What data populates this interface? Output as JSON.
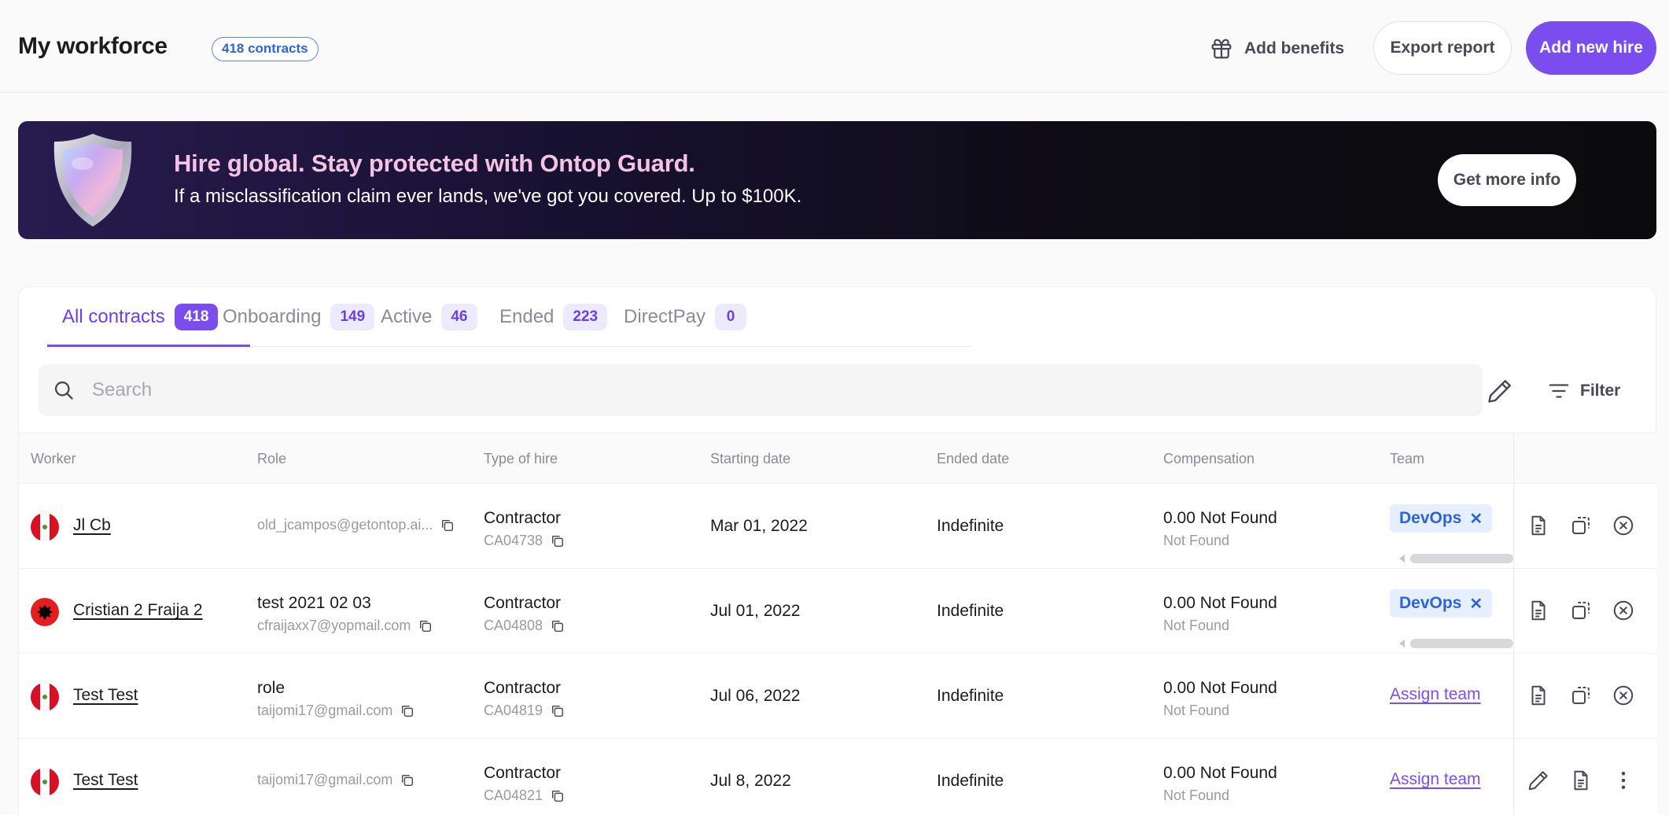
{
  "header": {
    "title": "My workforce",
    "contracts_chip": "418 contracts",
    "add_benefits": "Add benefits",
    "export_report": "Export report",
    "add_new_hire": "Add new hire"
  },
  "banner": {
    "title": "Hire global. Stay protected with Ontop Guard.",
    "subtitle": "If a misclassification claim ever lands, we've got you covered. Up to $100K.",
    "cta": "Get more info"
  },
  "tabs": [
    {
      "label": "All contracts",
      "count": "418",
      "active": true
    },
    {
      "label": "Onboarding",
      "count": "149",
      "active": false
    },
    {
      "label": "Active",
      "count": "46",
      "active": false
    },
    {
      "label": "Ended",
      "count": "223",
      "active": false
    },
    {
      "label": "DirectPay",
      "count": "0",
      "active": false
    }
  ],
  "search": {
    "placeholder": "Search"
  },
  "filter_label": "Filter",
  "columns": [
    "Worker",
    "Role",
    "Type of hire",
    "Starting date",
    "Ended date",
    "Compensation",
    "Team"
  ],
  "rows": [
    {
      "flag": "peru",
      "name": "Jl Cb",
      "role": "",
      "email": "old_jcampos@getontop.ai...",
      "hire_type": "Contractor",
      "code": "CA04738",
      "start": "Mar 01, 2022",
      "end": "Indefinite",
      "comp": "0.00 Not Found",
      "comp_sub": "Not Found",
      "team": "DevOps",
      "assign_label": "",
      "actions": [
        "document-icon",
        "copy-contract-icon",
        "cancel-icon"
      ]
    },
    {
      "flag": "albania",
      "name": "Cristian 2 Fraija 2",
      "role": "test 2021 02 03",
      "email": "cfraijaxx7@yopmail.com",
      "hire_type": "Contractor",
      "code": "CA04808",
      "start": "Jul 01, 2022",
      "end": "Indefinite",
      "comp": "0.00 Not Found",
      "comp_sub": "Not Found",
      "team": "DevOps",
      "assign_label": "",
      "actions": [
        "document-icon",
        "copy-contract-icon",
        "cancel-icon"
      ]
    },
    {
      "flag": "peru",
      "name": "Test Test",
      "role": "role",
      "email": "taijomi17@gmail.com",
      "hire_type": "Contractor",
      "code": "CA04819",
      "start": "Jul 06, 2022",
      "end": "Indefinite",
      "comp": "0.00 Not Found",
      "comp_sub": "Not Found",
      "team": "",
      "assign_label": "Assign team",
      "actions": [
        "document-icon",
        "copy-contract-icon",
        "cancel-icon"
      ]
    },
    {
      "flag": "peru",
      "name": "Test Test",
      "role": "",
      "email": "taijomi17@gmail.com",
      "hire_type": "Contractor",
      "code": "CA04821",
      "start": "Jul 8, 2022",
      "end": "Indefinite",
      "comp": "0.00 Not Found",
      "comp_sub": "Not Found",
      "team": "",
      "assign_label": "Assign team",
      "actions": [
        "edit-icon",
        "document-icon",
        "more-vertical-icon"
      ]
    }
  ],
  "colors": {
    "accent": "#7c4dee",
    "chip_blue": "#2f64d6",
    "banner_title": "#f3c2e4"
  }
}
